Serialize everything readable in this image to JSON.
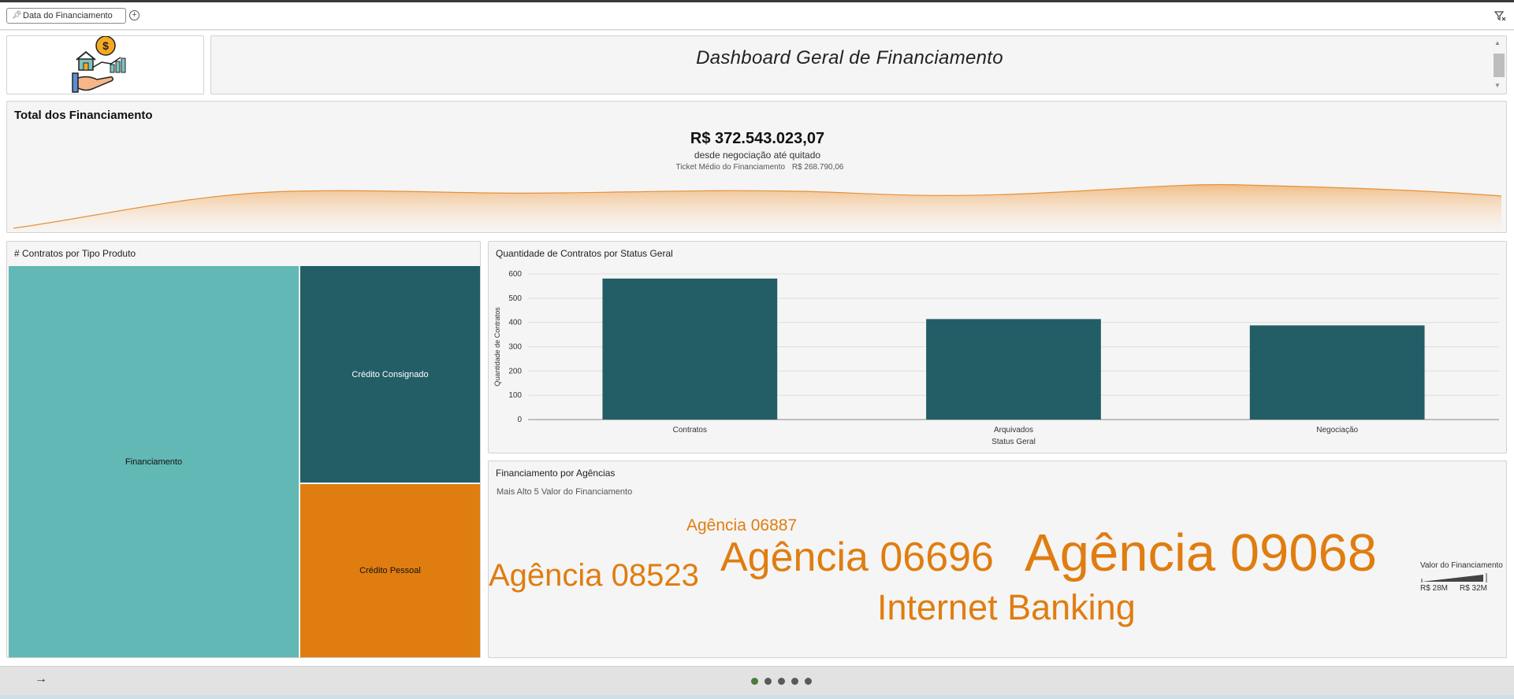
{
  "filter_bar": {
    "chip_label": "Data do Financiamento"
  },
  "dashboard": {
    "title": "Dashboard Geral de Financiamento"
  },
  "total": {
    "heading": "Total dos Financiamento",
    "value": "R$ 372.543.023,07",
    "subtitle": "desde negociação até quitado",
    "ticket_label": "Ticket Médio do Financiamento",
    "ticket_value": "R$ 268.790,06"
  },
  "treemap": {
    "title": "# Contratos por Tipo Produto",
    "items": [
      {
        "label": "Financiamento",
        "color": "#62b8b4"
      },
      {
        "label": "Crédito Consignado",
        "color": "#235e67"
      },
      {
        "label": "Crédito Pessoal",
        "color": "#e07d10"
      }
    ]
  },
  "bar_chart": {
    "title": "Quantidade de Contratos por Status Geral"
  },
  "word_cloud": {
    "title": "Financiamento por Agências",
    "subtitle": "Mais Alto 5 Valor do Financiamento",
    "words": [
      {
        "text": "Agência 06887"
      },
      {
        "text": "Agência 06696"
      },
      {
        "text": "Agência 09068"
      },
      {
        "text": "Agência 08523"
      },
      {
        "text": "Internet Banking"
      }
    ],
    "legend_title": "Valor do Financiamento",
    "legend_min": "R$ 28M",
    "legend_max": "R$ 32M"
  },
  "footer": {
    "arrow": "→",
    "page_count": 5,
    "active_page": 1
  },
  "colors": {
    "teal_dark": "#235e67",
    "teal_light": "#62b8b4",
    "orange": "#e07d10"
  },
  "chart_data": {
    "type": "bar",
    "title": "Quantidade de Contratos por Status Geral",
    "xlabel": "Status Geral",
    "ylabel": "Quantidade de Contratos",
    "categories": [
      "Contratos",
      "Arquivados",
      "Negociação"
    ],
    "values": [
      581,
      414,
      388
    ],
    "ylim": [
      0,
      600
    ],
    "yticks": [
      0,
      100,
      200,
      300,
      400,
      500,
      600
    ],
    "grid": true,
    "color": "#235e67"
  }
}
